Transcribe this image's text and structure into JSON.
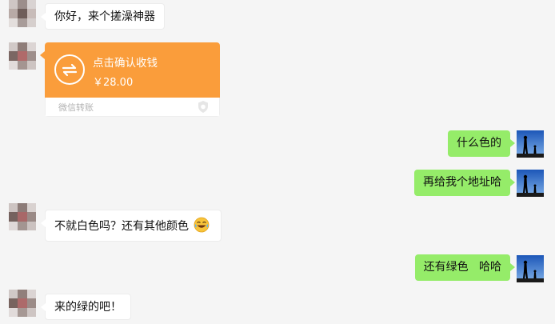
{
  "chat": {
    "messages": [
      {
        "side": "left",
        "type": "text",
        "text": "你好，来个搓澡神器"
      },
      {
        "side": "left",
        "type": "transfer",
        "title": "点击确认收钱",
        "amount": "￥28.00",
        "footer": "微信转账"
      },
      {
        "side": "right",
        "type": "text",
        "text": "什么色的"
      },
      {
        "side": "right",
        "type": "text",
        "text": "再给我个地址哈"
      },
      {
        "side": "left",
        "type": "text",
        "text": "不就白色吗？还有其他颜色",
        "emoji": "laughing-tears-emoji"
      },
      {
        "side": "right",
        "type": "text",
        "text": "还有绿色   哈哈"
      },
      {
        "side": "left",
        "type": "text",
        "text": "来的绿的吧！"
      }
    ]
  },
  "colors": {
    "background": "#f5f5f5",
    "incoming_bubble": "#ffffff",
    "outgoing_bubble": "#95ec69",
    "transfer_card": "#fa9d3b"
  }
}
